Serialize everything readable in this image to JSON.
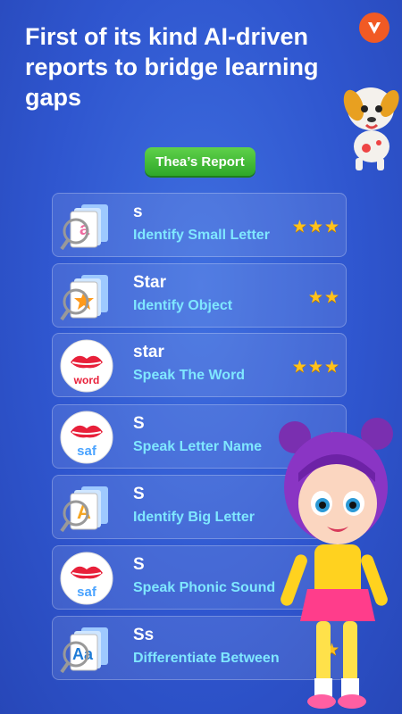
{
  "headline": "First of its kind AI-driven reports to bridge learning gaps",
  "report_button": "Thea’s Report",
  "logo_icon": "v-logo-icon",
  "colors": {
    "accent_green": "#3cb634",
    "subtitle_cyan": "#7fe7ff",
    "star_gold": "#ffc21c"
  },
  "items": [
    {
      "title": "s",
      "subtitle": "Identify Small Letter",
      "stars": "★★★",
      "icon": "small-letter-flashcard-icon"
    },
    {
      "title": "Star",
      "subtitle": "Identify Object",
      "stars": "★★",
      "icon": "object-flashcard-icon"
    },
    {
      "title": "star",
      "subtitle": "Speak The Word",
      "stars": "★★★",
      "icon": "speak-word-lips-icon",
      "icon_text": "word"
    },
    {
      "title": "S",
      "subtitle": "Speak Letter Name",
      "stars": "★",
      "icon": "speak-letter-lips-icon",
      "icon_text": "saf"
    },
    {
      "title": "S",
      "subtitle": "Identify Big Letter",
      "stars": "★",
      "icon": "big-letter-flashcard-icon"
    },
    {
      "title": "S",
      "subtitle": "Speak Phonic Sound",
      "stars": "★",
      "icon": "speak-phonic-lips-icon",
      "icon_text": "saf"
    },
    {
      "title": "Ss",
      "subtitle": "Differentiate Between",
      "stars": "★",
      "icon": "differentiate-flashcard-icon"
    }
  ]
}
